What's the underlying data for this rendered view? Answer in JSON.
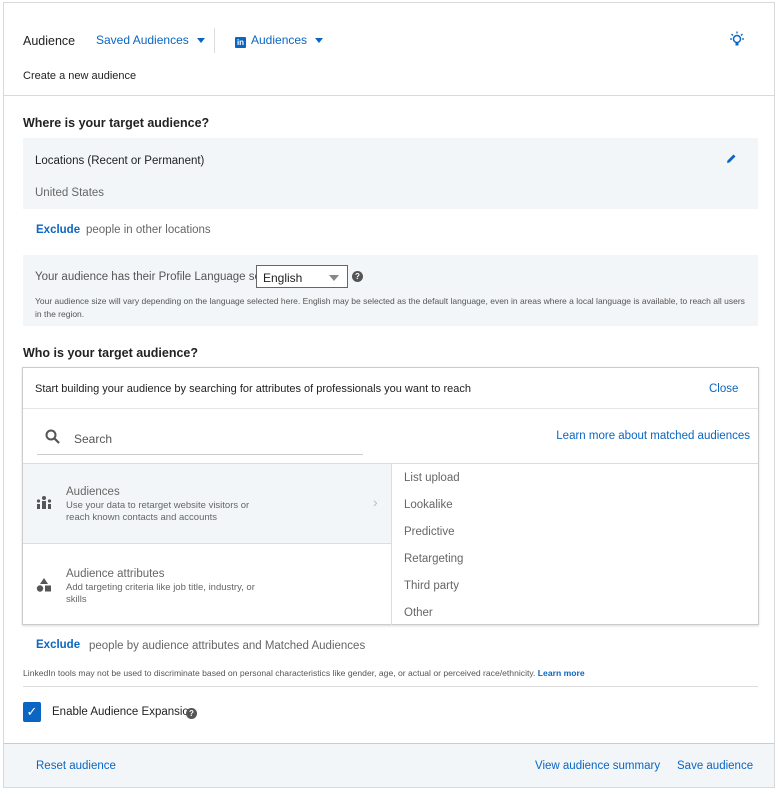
{
  "header": {
    "title": "Audience",
    "saved_audiences": "Saved Audiences",
    "audiences": "Audiences",
    "subtitle": "Create a new audience"
  },
  "where": {
    "heading": "Where is your target audience?",
    "locations_label": "Locations (Recent or Permanent)",
    "location_value": "United States",
    "exclude": "Exclude",
    "exclude_text": "people in other locations",
    "language_prefix": "Your audience has their Profile Language set to",
    "language_value": "English",
    "language_note": "Your audience size will vary depending on the language selected here. English may be selected as the default language, even in areas where a local language is available, to reach all users in the region."
  },
  "who": {
    "heading": "Who is your target audience?",
    "prompt": "Start building your audience by searching for attributes of professionals you want to reach",
    "close": "Close",
    "search_placeholder": "Search",
    "learn_matched": "Learn more about matched audiences",
    "categories": [
      {
        "title": "Audiences",
        "desc": "Use your data to retarget website visitors or reach known contacts and accounts"
      },
      {
        "title": "Audience attributes",
        "desc": "Add targeting criteria like job title, industry, or skills"
      }
    ],
    "options": [
      "List upload",
      "Lookalike",
      "Predictive",
      "Retargeting",
      "Third party",
      "Other"
    ],
    "exclude": "Exclude",
    "exclude_text": "people by audience attributes and Matched Audiences",
    "disclaimer": "LinkedIn tools may not be used to discriminate based on personal characteristics like gender, age, or actual or perceived race/ethnicity.",
    "learn_more": "Learn more",
    "expansion_label": "Enable Audience Expansion",
    "expansion_checked": true
  },
  "footer": {
    "reset": "Reset audience",
    "view_summary": "View audience summary",
    "save": "Save audience"
  },
  "colors": {
    "accent": "#0a66c2",
    "panel": "#f3f6f8"
  }
}
